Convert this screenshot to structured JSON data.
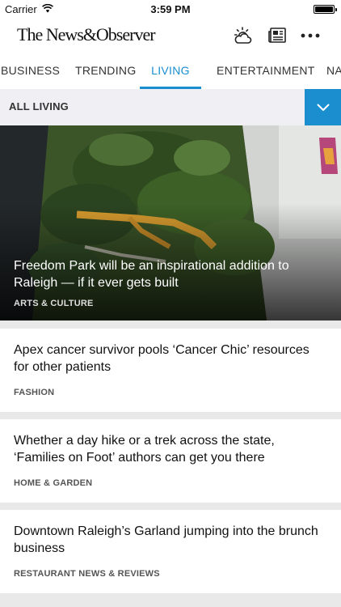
{
  "status": {
    "carrier": "Carrier",
    "time": "3:59 PM"
  },
  "header": {
    "logo": "The News&Observer",
    "icons": [
      "weather-icon",
      "newspaper-icon",
      "more-icon"
    ]
  },
  "tabs": [
    {
      "label": "BUSINESS",
      "active": false
    },
    {
      "label": "TRENDING",
      "active": false
    },
    {
      "label": "LIVING",
      "active": true
    },
    {
      "label": "ENTERTAINMENT",
      "active": false
    },
    {
      "label": "NATION",
      "active": false
    }
  ],
  "section": {
    "title": "ALL LIVING",
    "toggle_icon": "chevron-down-icon"
  },
  "hero": {
    "headline": "Freedom Park will be an inspirational addition to Raleigh — if it ever gets built",
    "category": "ARTS & CULTURE"
  },
  "articles": [
    {
      "headline": "Apex cancer survivor pools ‘Cancer Chic’ resources for other patients",
      "category": "FASHION"
    },
    {
      "headline": "Whether a day hike or a trek across the state, ‘Families on Foot’ authors can get you there",
      "category": "HOME & GARDEN"
    },
    {
      "headline": "Downtown Raleigh’s Garland jumping into the brunch business",
      "category": "RESTAURANT NEWS & REVIEWS"
    }
  ],
  "colors": {
    "accent": "#1a8ecf",
    "background": "#e9e9e9"
  }
}
